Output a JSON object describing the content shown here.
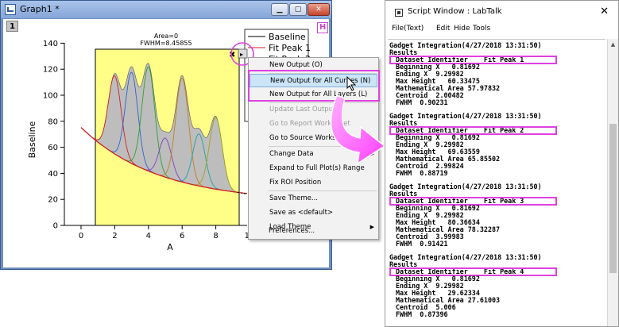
{
  "graph_window": {
    "title": "Graph1 *",
    "layer_label": "1",
    "h_badge": "H",
    "annotation_area": "Area=0",
    "annotation_fwhm": "FWHM=8.45855",
    "x_axis_title": "A",
    "y_axis_title": "Baseline",
    "x_ticks": [
      "0",
      "2",
      "4",
      "6",
      "8",
      "10"
    ],
    "y_ticks": [
      "0",
      "20",
      "40",
      "60",
      "80",
      "100",
      "120",
      "140"
    ],
    "legend": [
      "Baseline",
      "Fit Peak 1",
      "Fit Peak 2"
    ],
    "roi_button": "▸",
    "colors": {
      "roi_fill": "#ffff88",
      "baseline": "#d02020",
      "peak_fill": "#bdbdbd",
      "highlight": "#e040e0"
    }
  },
  "context_menu": {
    "items": [
      {
        "label": "New Output (O)",
        "state": "normal"
      },
      {
        "label": "New Output for All Curves (N)",
        "state": "highlighted"
      },
      {
        "label": "New Output for All Layers (L)",
        "state": "normal"
      },
      {
        "label": "Update Last Output",
        "state": "disabled"
      },
      {
        "label": "Go to Report Worksheet",
        "state": "disabled"
      },
      {
        "label": "Go to Source Worksheet",
        "state": "normal"
      },
      {
        "label": "Change Data",
        "state": "submenu"
      },
      {
        "label": "Expand to Full Plot(s) Range",
        "state": "normal"
      },
      {
        "label": "Fix ROI Position",
        "state": "normal"
      },
      {
        "label": "Save Theme...",
        "state": "normal"
      },
      {
        "label": "Save as <default>",
        "state": "normal"
      },
      {
        "label": "Load Theme",
        "state": "submenu"
      },
      {
        "label": "Preferences...",
        "state": "normal"
      }
    ]
  },
  "script_window": {
    "title": "Script Window : LabTalk",
    "close": "✕",
    "menu": [
      "File(Text)",
      "Edit",
      "Hide",
      "Tools"
    ],
    "blocks": [
      {
        "header": "Gadget Integration(4/27/2018 13:31:50)",
        "results": "Results",
        "dataset": "Dataset Identifier    Fit Peak 1",
        "lines": [
          "Beginning X   0.81692",
          "Ending X  9.29982",
          "Max Height   60.33475",
          "Mathematical Area 57.97832",
          "Centroid  2.00482",
          "FWHM  0.90231"
        ]
      },
      {
        "header": "Gadget Integration(4/27/2018 13:31:50)",
        "results": "Results",
        "dataset": "Dataset Identifier    Fit Peak 2",
        "lines": [
          "Beginning X   0.81692",
          "Ending X  9.29982",
          "Max Height   69.63559",
          "Mathematical Area 65.85502",
          "Centroid  2.99824",
          "FWHM  0.88719"
        ]
      },
      {
        "header": "Gadget Integration(4/27/2018 13:31:50)",
        "results": "Results",
        "dataset": "Dataset Identifier    Fit Peak 3",
        "lines": [
          "Beginning X   0.81692",
          "Ending X  9.29982",
          "Max Height   80.36634",
          "Mathematical Area 78.32287",
          "Centroid  3.99983",
          "FWHM  0.91421"
        ]
      },
      {
        "header": "Gadget Integration(4/27/2018 13:31:50)",
        "results": "Results",
        "dataset": "Dataset Identifier    Fit Peak 4",
        "lines": [
          "Beginning X   0.81692",
          "Ending X  9.29982",
          "Max Height   29.62334",
          "Mathematical Area 27.61003",
          "Centroid  5.006",
          "FWHM  0.87396"
        ]
      }
    ]
  }
}
